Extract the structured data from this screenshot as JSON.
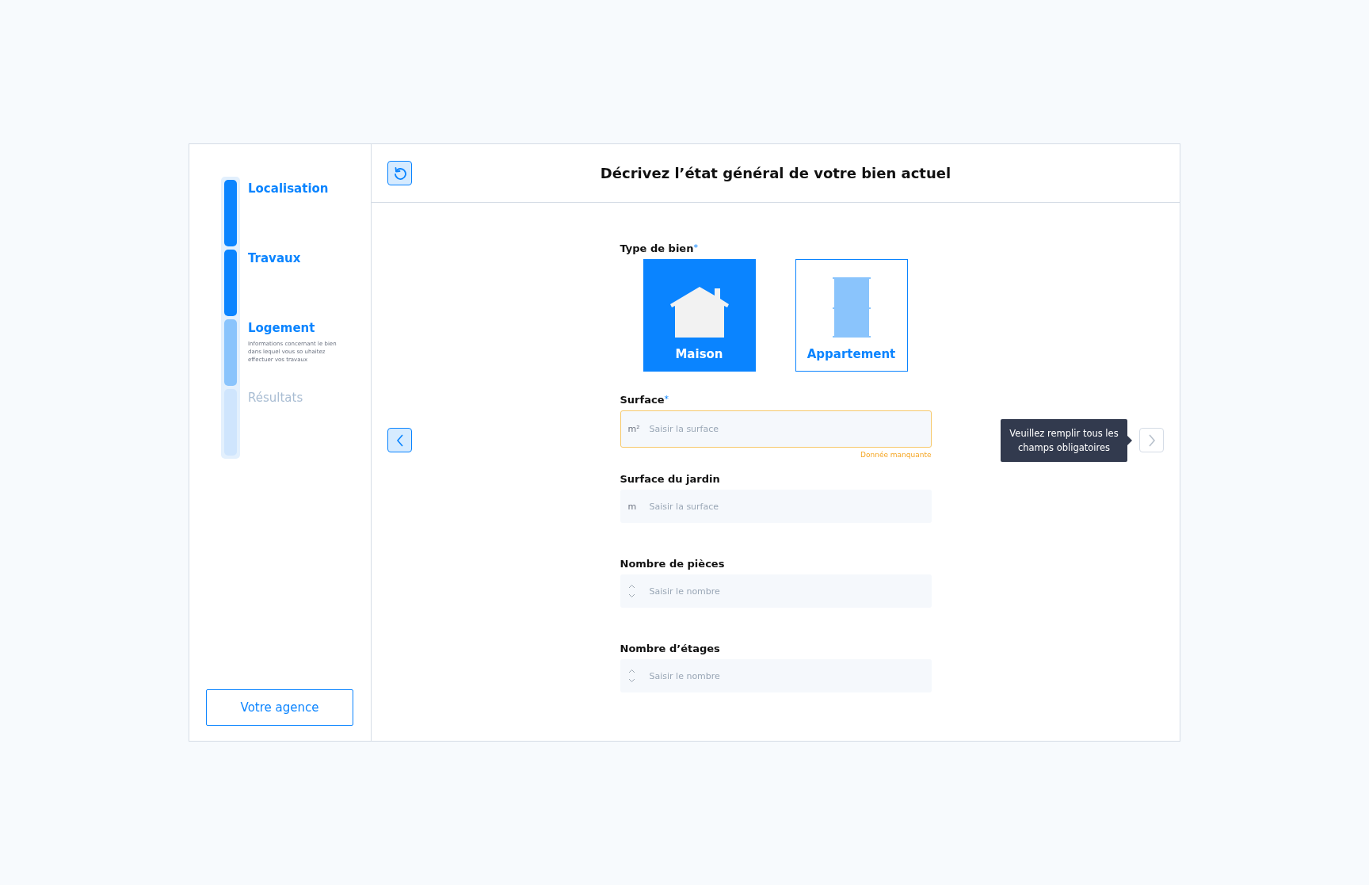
{
  "steps": [
    {
      "label": "Localisation",
      "done": true,
      "current": false
    },
    {
      "label": "Travaux",
      "done": true,
      "current": false
    },
    {
      "label": "Logement",
      "done": false,
      "current": true,
      "description": "Informations concernant le bien dans lequel vous so uhaitez effectuer vos travaux"
    },
    {
      "label": "Résultats",
      "done": false,
      "current": false
    }
  ],
  "agency_button": "Votre agence",
  "header": {
    "title": "Décrivez l’état général de votre bien actuel"
  },
  "property_type": {
    "label": "Type de bien",
    "required_mark": "*",
    "options": [
      {
        "label": "Maison",
        "kind": "house",
        "selected": true
      },
      {
        "label": "Appartement",
        "kind": "building",
        "selected": false
      }
    ]
  },
  "fields": [
    {
      "label": "Surface",
      "required_mark": "*",
      "kind": "unit",
      "unit": "m²",
      "placeholder": "Saisir la surface",
      "error": "Donnée manquante"
    },
    {
      "label": "Surface du jardin",
      "kind": "unit",
      "unit": "m",
      "placeholder": "Saisir la surface"
    },
    {
      "label": "Nombre de pièces",
      "kind": "number",
      "placeholder": "Saisir le nombre"
    },
    {
      "label": "Nombre d’étages",
      "kind": "number",
      "placeholder": "Saisir le nombre"
    }
  ],
  "tooltip": "Veuillez remplir tous les champs obligatoires",
  "next_disabled": true
}
